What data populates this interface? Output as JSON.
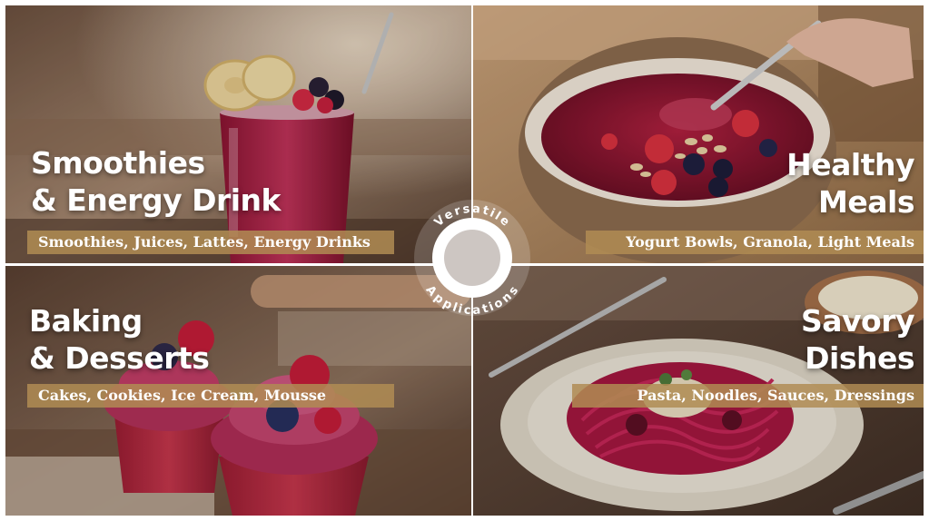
{
  "badge": {
    "top_text": "Versatile",
    "bottom_text": "Applications"
  },
  "panels": [
    {
      "id": "smoothies",
      "title_line1": "Smoothies",
      "title_line2": "& Energy Drink",
      "subtitle": "Smoothies, Juices, Lattes, Energy Drinks"
    },
    {
      "id": "healthy",
      "title_line1": "Healthy",
      "title_line2": "Meals",
      "subtitle": "Yogurt Bowls, Granola, Light Meals"
    },
    {
      "id": "baking",
      "title_line1": "Baking",
      "title_line2": "& Desserts",
      "subtitle": "Cakes, Cookies, Ice Cream, Mousse"
    },
    {
      "id": "savory",
      "title_line1": "Savory",
      "title_line2": "Dishes",
      "subtitle": "Pasta, Noodles, Sauces, Dressings"
    }
  ],
  "colors": {
    "accent_band": "#b08c54",
    "berry": "#8f1d3f",
    "text_on_photo": "#ffffff"
  }
}
